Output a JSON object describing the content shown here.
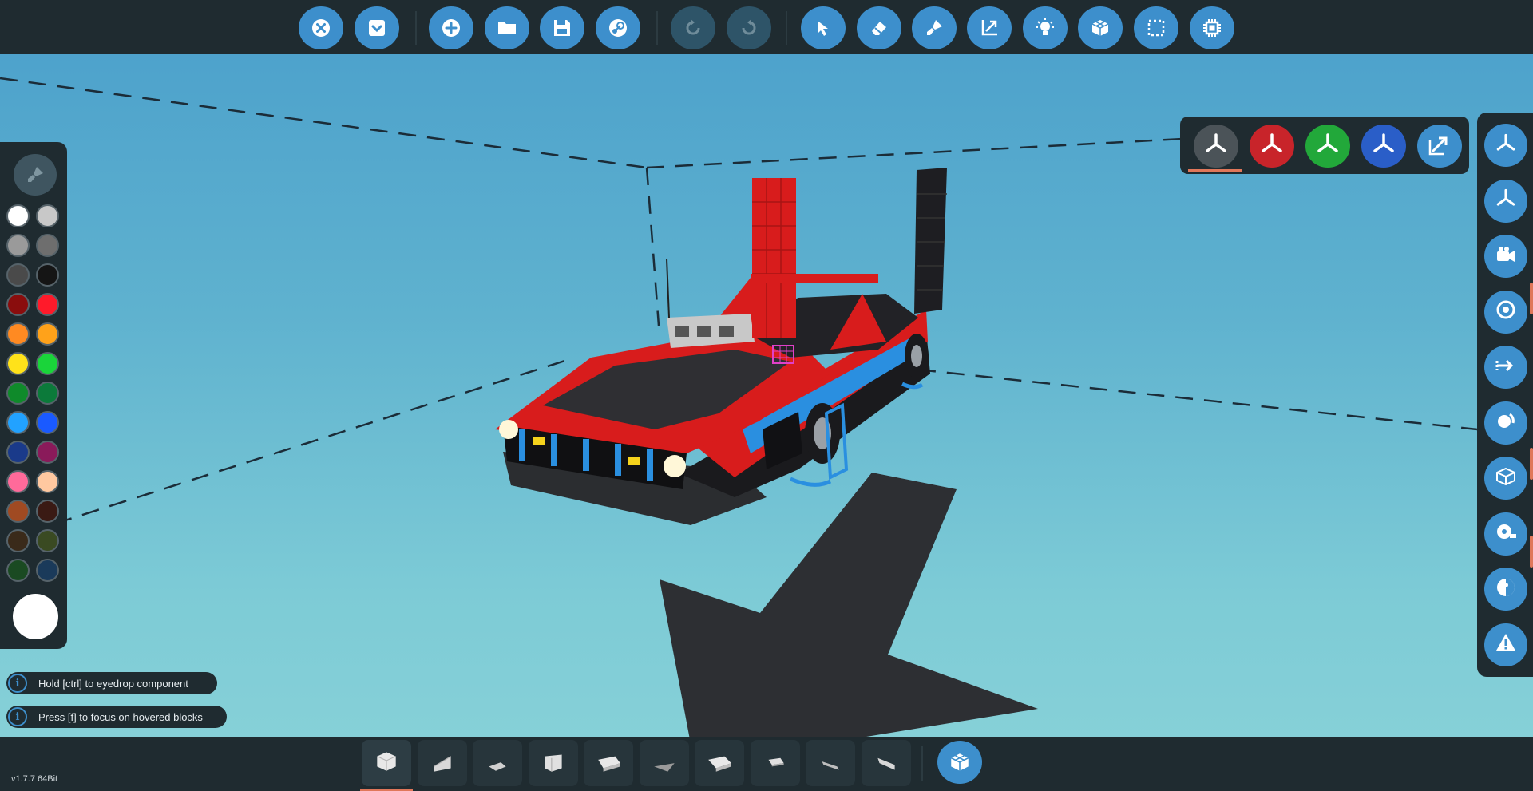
{
  "toolbar": {
    "buttons": [
      {
        "icon": "close-icon",
        "enabled": true
      },
      {
        "icon": "dropdown-icon",
        "enabled": true
      },
      {
        "icon": "new-icon",
        "enabled": true
      },
      {
        "icon": "folder-icon",
        "enabled": true
      },
      {
        "icon": "save-icon",
        "enabled": true
      },
      {
        "icon": "steam-icon",
        "enabled": true
      },
      {
        "icon": "undo-icon",
        "enabled": false
      },
      {
        "icon": "redo-icon",
        "enabled": false
      },
      {
        "icon": "select-cursor-icon",
        "enabled": true
      },
      {
        "icon": "eraser-icon",
        "enabled": true
      },
      {
        "icon": "paint-brush-icon",
        "enabled": true
      },
      {
        "icon": "move-resize-icon",
        "enabled": true
      },
      {
        "icon": "light-bulb-icon",
        "enabled": true
      },
      {
        "icon": "blocks-icon",
        "enabled": true
      },
      {
        "icon": "box-select-icon",
        "enabled": true
      },
      {
        "icon": "chip-icon",
        "enabled": true
      }
    ]
  },
  "palette": {
    "colors": [
      [
        "#ffffff",
        "#c8c8c8"
      ],
      [
        "#9a9a9a",
        "#6e6e6e"
      ],
      [
        "#4a4a4a",
        "#151515"
      ],
      [
        "#8a0d0d",
        "#ff1a2a"
      ],
      [
        "#ff8a22",
        "#ffa21a"
      ],
      [
        "#ffe21a",
        "#1ad43a"
      ],
      [
        "#0f8a2a",
        "#0b7a3a"
      ],
      [
        "#22a2ff",
        "#1a5aff"
      ],
      [
        "#1a3a8a",
        "#8a1a5a"
      ],
      [
        "#ff6a9a",
        "#ffc8a0"
      ],
      [
        "#a04a22",
        "#3a1a14"
      ],
      [
        "#3a2a1a",
        "#3a4a22"
      ],
      [
        "#1a4a22",
        "#1a3a5a"
      ]
    ],
    "current_color": "#ffffff"
  },
  "axis_panel": {
    "buttons": [
      {
        "icon": "axis-all-icon",
        "color": "#4b5358",
        "selected": true
      },
      {
        "icon": "axis-x-icon",
        "color": "#c8242a",
        "selected": false
      },
      {
        "icon": "axis-y-icon",
        "color": "#22a83a",
        "selected": false
      },
      {
        "icon": "axis-z-icon",
        "color": "#2a5ec8",
        "selected": false
      },
      {
        "icon": "axis-scale-icon",
        "color": "#3d8fcc",
        "selected": false
      }
    ]
  },
  "rightbar": {
    "buttons": [
      {
        "icon": "axis-view-icon"
      },
      {
        "icon": "axis-view-alt-icon"
      },
      {
        "icon": "camera-icon"
      },
      {
        "icon": "target-icon"
      },
      {
        "icon": "mirror-icon"
      },
      {
        "icon": "rotate-icon"
      },
      {
        "icon": "bounding-box-icon"
      },
      {
        "icon": "measure-icon"
      },
      {
        "icon": "center-of-mass-icon"
      },
      {
        "icon": "warning-icon"
      }
    ]
  },
  "hints": [
    {
      "text": "Hold [ctrl] to eyedrop component"
    },
    {
      "text": "Press [f] to focus on hovered blocks"
    }
  ],
  "block_bar": {
    "slots": [
      {
        "icon": "cube-block-icon",
        "active": true
      },
      {
        "icon": "wedge-block-icon",
        "active": false
      },
      {
        "icon": "pyramid-block-icon",
        "active": false
      },
      {
        "icon": "corner-block-icon",
        "active": false
      },
      {
        "icon": "slab-block-icon",
        "active": false
      },
      {
        "icon": "thin-wedge-block-icon",
        "active": false
      },
      {
        "icon": "long-wedge-block-icon",
        "active": false
      },
      {
        "icon": "small-wedge-block-icon",
        "active": false
      },
      {
        "icon": "thin-slope-block-icon",
        "active": false
      },
      {
        "icon": "small-slope-block-icon",
        "active": false
      }
    ],
    "extra_icon": "blocks-menu-icon"
  },
  "version": "v1.7.7 64Bit"
}
